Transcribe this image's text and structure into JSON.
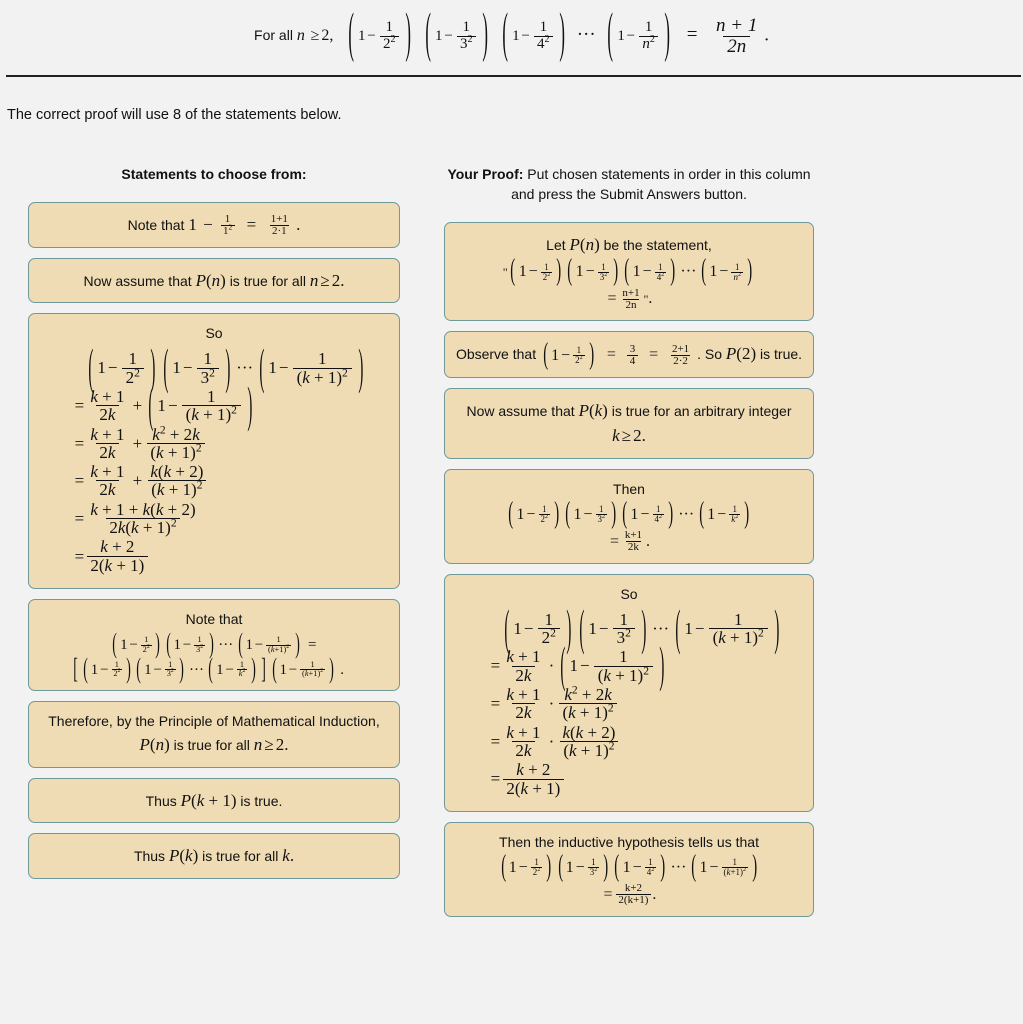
{
  "banner": {
    "prefix": "For all",
    "var": "n",
    "relation": "≥",
    "bound": "2,",
    "product_terms": [
      "2",
      "3",
      "4"
    ],
    "last_term": "n",
    "rhs_num": "n + 1",
    "rhs_den": "2n",
    "period": "."
  },
  "intro": {
    "text": "The correct proof will use 8 of the statements below.",
    "count": "8"
  },
  "left_column": {
    "heading": "Statements to choose from:",
    "items": [
      {
        "id": "note-that-base-case-wrong",
        "kind": "inline",
        "prefix": "Note that",
        "one": "1",
        "minus": "−",
        "frac1_num": "1",
        "frac1_den": "1",
        "frac1_den_exp": "2",
        "equals": "=",
        "frac2_num": "1+1",
        "frac2_den": "2·1",
        "period": "."
      },
      {
        "id": "now-assume-pn-all-n",
        "kind": "text",
        "text_parts": [
          "Now assume that",
          "P(n)",
          "is true for all",
          "n ≥ 2."
        ]
      },
      {
        "id": "so-additive",
        "kind": "so-block",
        "caption": "So",
        "op": "+",
        "lines": [
          "product (1-1/2^2)(1-1/3^2) ... (1-1/(k+1)^2)",
          "= (k+1)/(2k) + (1 - 1/(k+1)^2)",
          "= (k+1)/(2k) + (k^2+2k)/((k+1)^2)",
          "= (k+1)/(2k) + k(k+2)/((k+1)^2)",
          "= (k+1+k(k+2))/(2k(k+1)^2)",
          "= (k+2)/(2(k+1))"
        ]
      },
      {
        "id": "note-that-split-product",
        "kind": "note-split",
        "caption": "Note that"
      },
      {
        "id": "therefore-pmi",
        "kind": "text",
        "text_parts": [
          "Therefore, by the Principle of Mathematical Induction,",
          "P(n)",
          "is true for all",
          "n ≥ 2."
        ]
      },
      {
        "id": "thus-pk1-true",
        "kind": "text",
        "text_parts": [
          "Thus",
          "P(k + 1)",
          "is true."
        ]
      },
      {
        "id": "thus-pk-true-all-k",
        "kind": "text",
        "text_parts": [
          "Thus",
          "P(k)",
          "is true for all",
          "k."
        ]
      }
    ]
  },
  "right_column": {
    "heading_bold": "Your Proof:",
    "heading_rest": "Put chosen statements in order in this column and press the Submit Answers button.",
    "submit_button_label": "Submit Answers",
    "items": [
      {
        "id": "let-pn-be-statement",
        "kind": "let-pn",
        "caption_pre": "Let",
        "caption_var": "P(n)",
        "caption_post": "be the statement,",
        "open_quote": "\"",
        "close_quote": "\"",
        "rhs_num": "n+1",
        "rhs_den": "2n",
        "period": "."
      },
      {
        "id": "observe-base-case",
        "kind": "observe",
        "prefix": "Observe that",
        "eq1_num": "3",
        "eq1_den": "4",
        "eq2_num": "2+1",
        "eq2_den": "2·2",
        "tail": ". So",
        "tail_var": "P(2)",
        "tail_post": "is true."
      },
      {
        "id": "now-assume-pk-arbitrary",
        "kind": "text",
        "text_parts": [
          "Now assume that",
          "P(k)",
          "is true for an arbitrary integer",
          "k ≥ 2."
        ]
      },
      {
        "id": "then-inductive-hypothesis",
        "kind": "then-block",
        "caption": "Then",
        "rhs_num": "k+1",
        "rhs_den": "2k",
        "period": "."
      },
      {
        "id": "so-multiplicative",
        "kind": "so-block",
        "caption": "So",
        "op": "·",
        "lines": [
          "product (1-1/2^2)(1-1/3^2) ... (1-1/(k+1)^2)",
          "= (k+1)/(2k) · (1 - 1/(k+1)^2)",
          "= (k+1)/(2k) · (k^2+2k)/((k+1)^2)",
          "= (k+1)/(2k) · k(k+2)/((k+1)^2)",
          "= (k+2)/(2(k+1))"
        ]
      },
      {
        "id": "then-inductive-hypothesis-tells-us",
        "kind": "ih-tells",
        "caption": "Then the inductive hypothesis tells us that",
        "rhs_num": "k+2",
        "rhs_den": "2(k+1)",
        "period": "."
      }
    ]
  },
  "colors": {
    "page_background": "#f2f2f2",
    "statement_fill": "#efdcb4",
    "statement_border": "#6f9a9a",
    "text": "#111111",
    "rule": "#222222"
  }
}
